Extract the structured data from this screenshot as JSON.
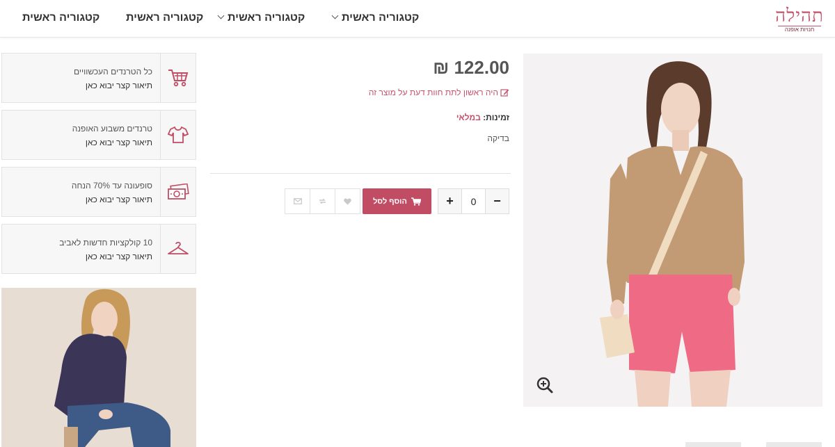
{
  "header": {
    "logo": {
      "main": "תהילה",
      "sub": "חנויות אופנה"
    },
    "nav": [
      {
        "label": "קטגוריה ראשית",
        "has_dropdown": true
      },
      {
        "label": "קטגוריה ראשית",
        "has_dropdown": true
      },
      {
        "label": "קטגוריה ראשית",
        "has_dropdown": false
      },
      {
        "label": "קטגוריה ראשית",
        "has_dropdown": false
      }
    ]
  },
  "product": {
    "price": "122.00 ₪",
    "review_link": "היה ראשון לתת חוות דעת על מוצר זה",
    "availability_label": "זמינות:",
    "availability_value": "במלאי",
    "description": "בדיקה",
    "quantity": "0",
    "qty_minus": "−",
    "qty_plus": "+",
    "add_to_cart": "הוסף לסל"
  },
  "features": [
    {
      "title": "כל הטרנדים העכשוויים",
      "subtitle": "תיאור קצר יבוא כאן",
      "icon": "shopping-cart-icon"
    },
    {
      "title": "טרנדים משבוע האופנה",
      "subtitle": "תיאור קצר יבוא כאן",
      "icon": "shirt-icon"
    },
    {
      "title": "סופעונה עד 70% הנחה",
      "subtitle": "תיאור קצר יבוא כאן",
      "icon": "money-icon"
    },
    {
      "title": "10 קולקציות חדשות לאביב",
      "subtitle": "תיאור קצר יבוא כאן",
      "icon": "hanger-icon"
    }
  ],
  "colors": {
    "accent": "#c04d64",
    "brand": "#c5526d",
    "text": "#333333"
  }
}
